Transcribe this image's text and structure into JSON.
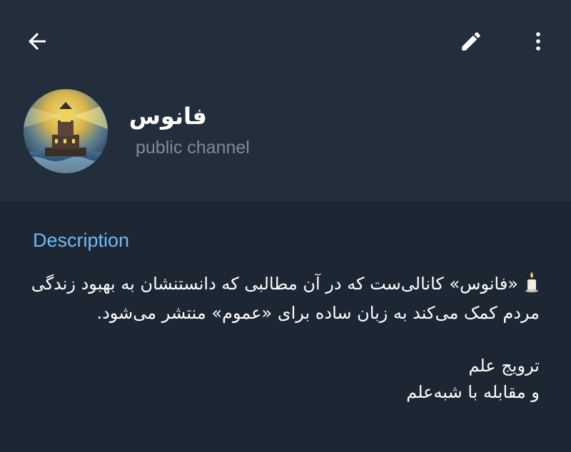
{
  "toolbar": {
    "back_icon": "arrow-left-icon",
    "edit_icon": "pencil-icon",
    "more_icon": "more-vertical-icon"
  },
  "profile": {
    "title": "فانوس",
    "subtitle": "public channel",
    "avatar_icon": "lighthouse-icon"
  },
  "info": {
    "section_label": "Description",
    "description_line1": "«فانوس» کانالی‌ست که در آن مطالبی که دانستنشان به بهبود زندگی مردم کمک می‌کند به زبان ساده برای «عموم» منتشر می‌شود.",
    "description_line2": "ترویج علم",
    "description_line3": "و مقابله با شبه‌علم",
    "emoji_icon": "candle-icon"
  },
  "colors": {
    "background": "#1d2733",
    "header_background": "#232e3c",
    "accent": "#71baf3",
    "muted_text": "#7d8b99"
  }
}
